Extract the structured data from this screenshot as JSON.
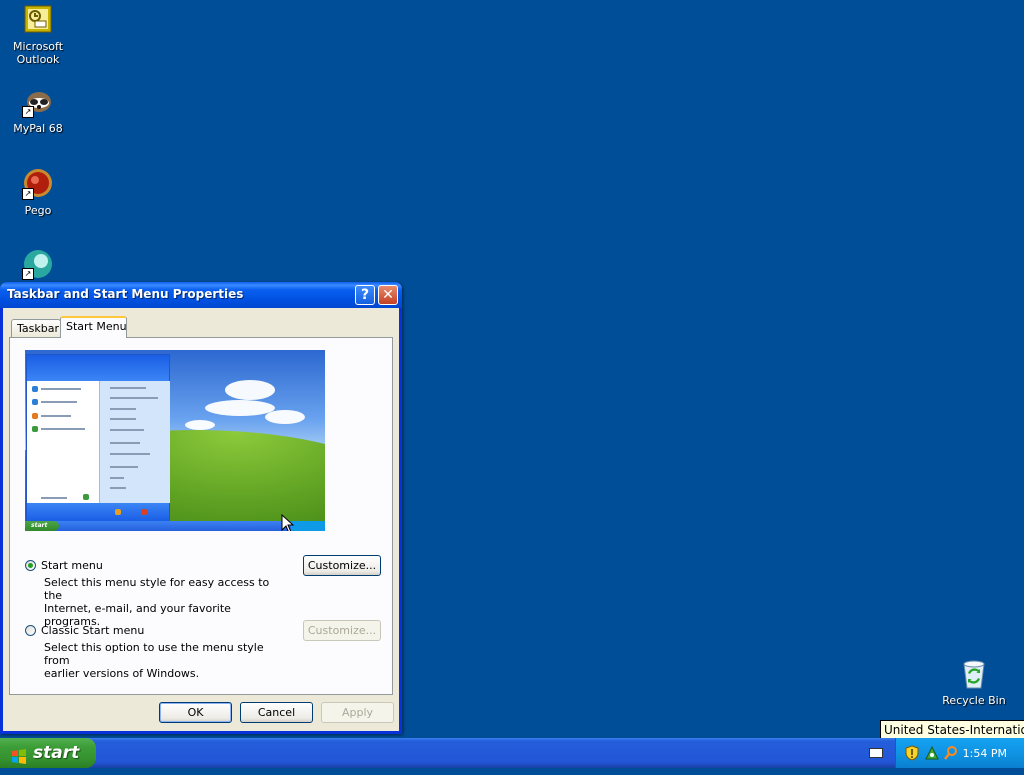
{
  "desktop": {
    "icons": [
      {
        "label_line1": "Microsoft",
        "label_line2": "Outlook",
        "icon": "outlook-icon"
      },
      {
        "label_line1": "MyPal 68",
        "label_line2": "",
        "icon": "mypal-icon"
      },
      {
        "label_line1": "Pego",
        "label_line2": "",
        "icon": "pego-icon"
      },
      {
        "label_line1": "",
        "label_line2": "",
        "icon": "globe-app-icon"
      }
    ],
    "recycle_bin": {
      "label": "Recycle Bin",
      "icon": "recycle-bin-icon"
    },
    "background_color": "#004e98"
  },
  "dialog": {
    "title": "Taskbar and Start Menu Properties",
    "help_label": "?",
    "close_label": "✕",
    "tabs": [
      {
        "label": "Taskbar",
        "active": false
      },
      {
        "label": "Start Menu",
        "active": true
      }
    ],
    "preview": {
      "mini_start_label": "start"
    },
    "options": [
      {
        "label": "Start menu",
        "checked": true,
        "description_line1": "Select this menu style for easy access to the",
        "description_line2": "Internet, e-mail, and your favorite programs.",
        "button": "Customize...",
        "button_enabled": true
      },
      {
        "label": "Classic Start menu",
        "checked": false,
        "description_line1": "Select this option to use the menu style from",
        "description_line2": "earlier versions of Windows.",
        "button": "Customize...",
        "button_enabled": false
      }
    ],
    "buttons": {
      "ok": "OK",
      "cancel": "Cancel",
      "apply": "Apply"
    }
  },
  "taskbar": {
    "start_label": "start",
    "clock": "1:54 PM",
    "tooltip": "United States-International",
    "tray_icons": [
      "keyboard-icon",
      "security-shield-icon",
      "network-icon",
      "search-icon"
    ]
  }
}
